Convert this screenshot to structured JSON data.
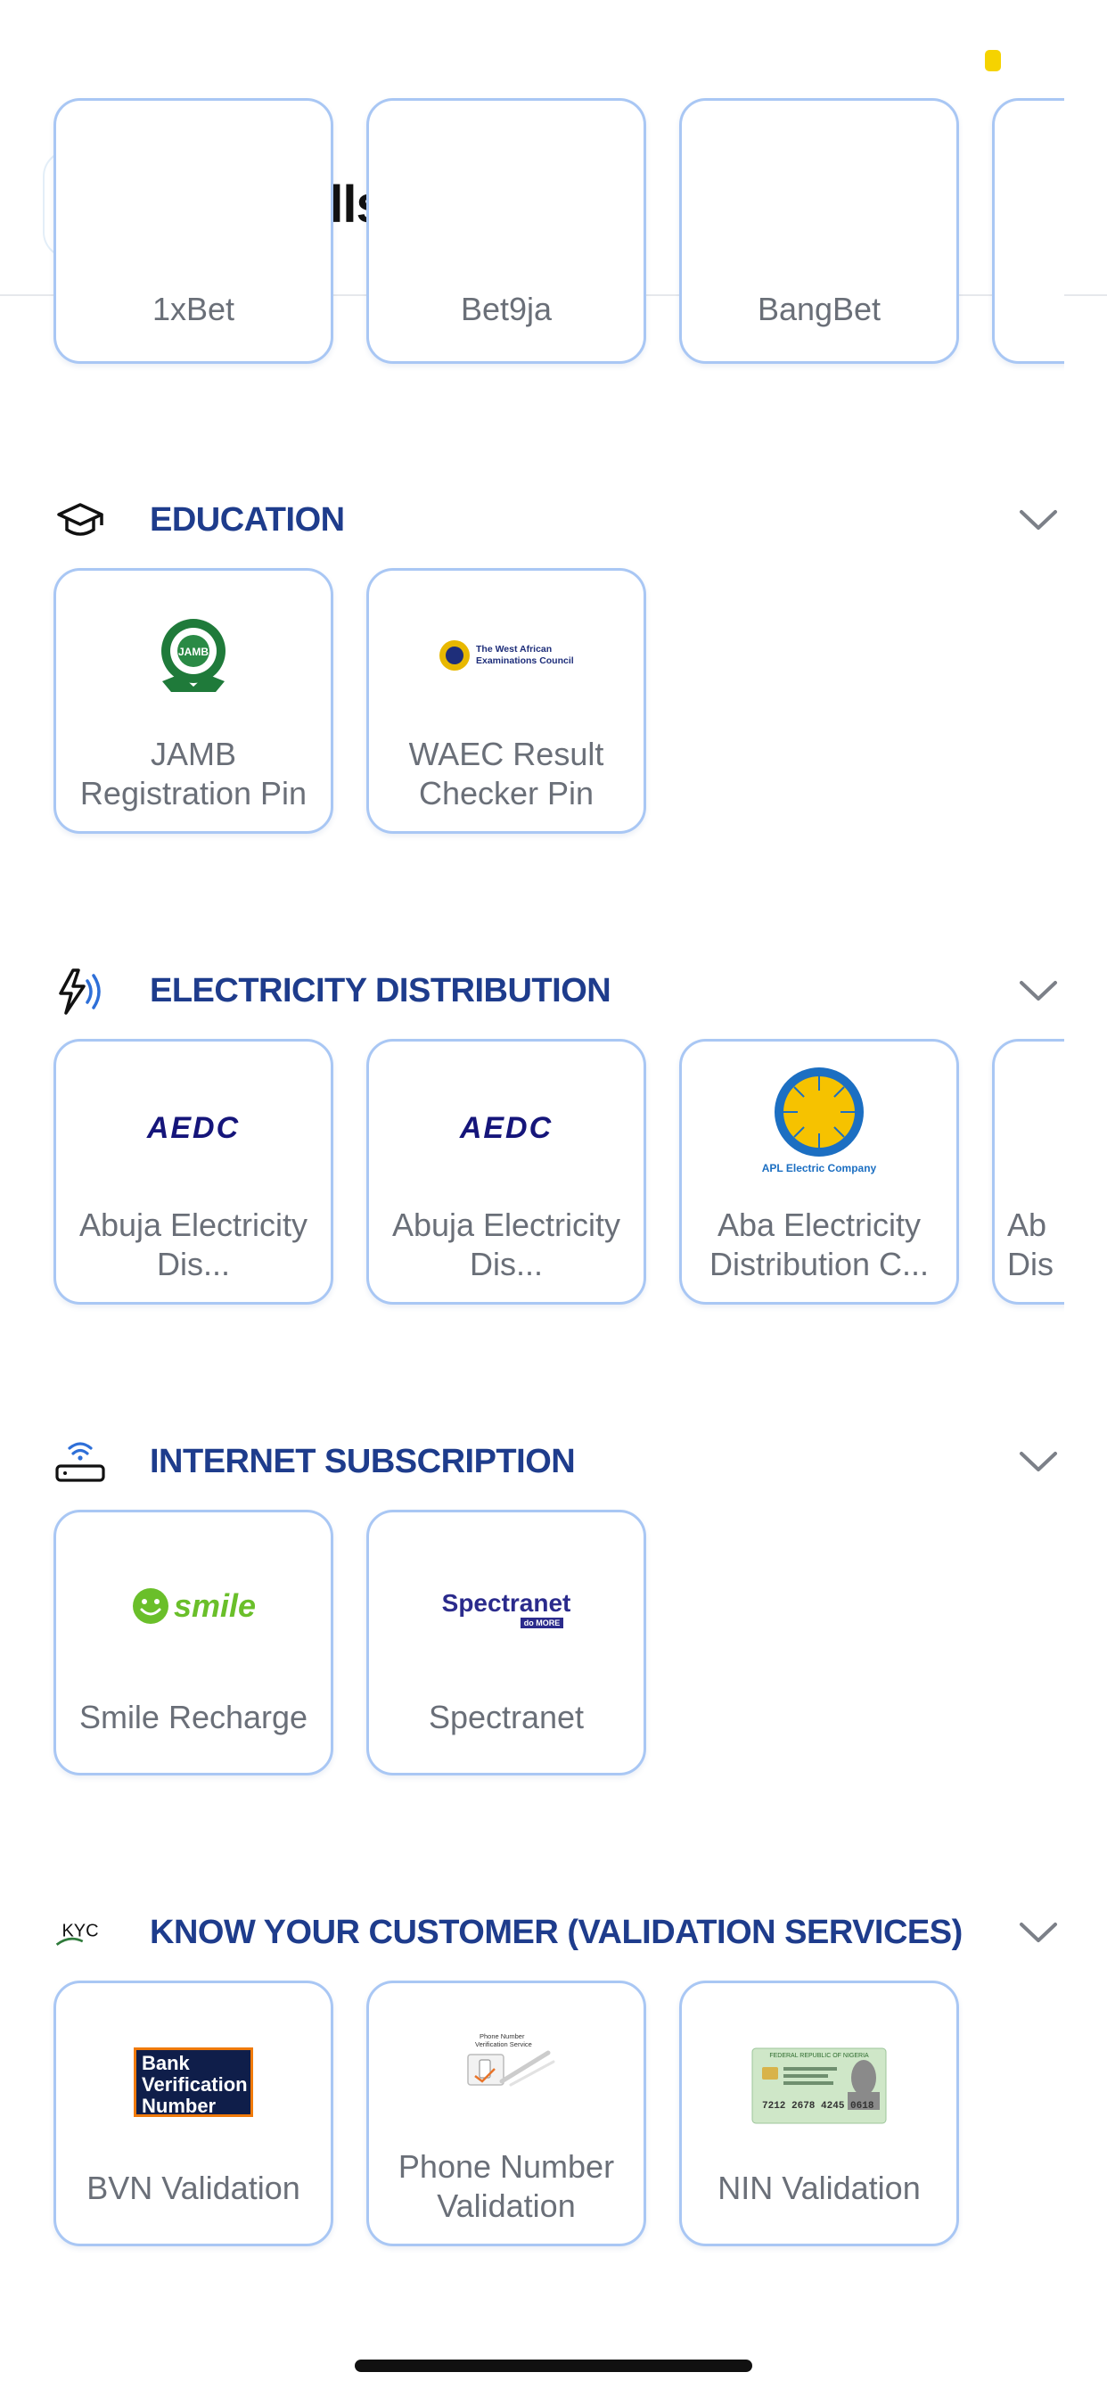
{
  "header": {
    "title": "Pay Bills"
  },
  "betting": {
    "items": [
      "1xBet",
      "Bet9ja",
      "BangBet"
    ]
  },
  "sections": {
    "education": {
      "title": "EDUCATION",
      "items": [
        {
          "label": "JAMB Registration Pin",
          "logo_text": "JAMB"
        },
        {
          "label": "WAEC Result Checker Pin",
          "logo_text": "The West African Examinations Council"
        }
      ]
    },
    "electricity": {
      "title": "ELECTRICITY DISTRIBUTION",
      "items": [
        {
          "label": "Abuja Electricity Dis...",
          "logo_text": "AEDC"
        },
        {
          "label": "Abuja Electricity Dis...",
          "logo_text": "AEDC"
        },
        {
          "label": "Aba Electricity Distribution C...",
          "logo_text": "APL Electric Company"
        },
        {
          "label": "Ab Dis"
        }
      ]
    },
    "internet": {
      "title": "INTERNET SUBSCRIPTION",
      "items": [
        {
          "label": "Smile Recharge",
          "logo_text": "smile"
        },
        {
          "label": "Spectranet",
          "logo_text": "Spectranet",
          "logo_subtext": "do MORE"
        }
      ]
    },
    "kyc": {
      "title": "KNOW YOUR CUSTOMER (VALIDATION SERVICES)",
      "icon_text": "KYC",
      "items": [
        {
          "label": "BVN Validation",
          "logo_text": "Bank Verification Number"
        },
        {
          "label": "Phone Number Validation",
          "logo_text": "Phone Number Verification Service"
        },
        {
          "label": "NIN Validation",
          "logo_text": "FEDERAL REPUBLIC OF NIGERIA",
          "logo_numbers": "7212 2678 4245 0618"
        }
      ]
    }
  },
  "colors": {
    "accent": "#1E3C8C",
    "card_border": "#A9C7F4",
    "label": "#6A6F78",
    "status_dot": "#F5D300"
  },
  "icons": [
    "arrow-left-icon",
    "graduation-cap-icon",
    "lightning-icon",
    "router-icon",
    "kyc-icon",
    "chevron-down-icon"
  ]
}
